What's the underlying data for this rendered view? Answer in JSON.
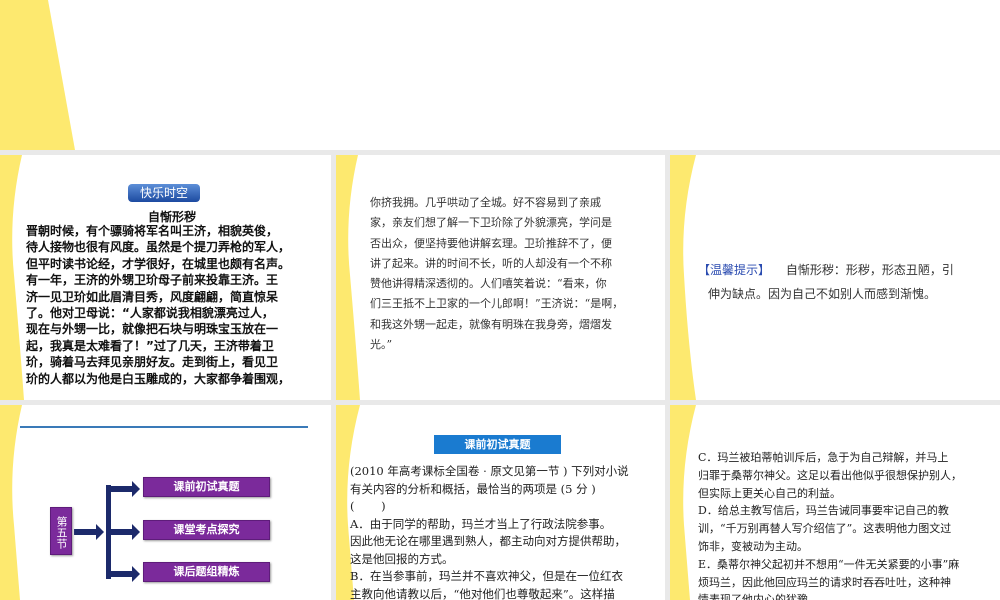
{
  "slides": [
    {
      "id": "top"
    },
    {
      "badge": "快乐时空",
      "title": "自惭形秽",
      "lines": [
        "晋朝时候，有个骠骑将军名叫王济，相貌英俊，",
        "待人接物也很有风度。虽然是个提刀弄枪的军人，",
        "但平时读书论经，才学很好，在城里也颇有名声。",
        "有一年，王济的外甥卫玠母子前来投靠王济。王",
        "济一见卫玠如此眉清目秀，风度翩翩，简直惊呆",
        "了。他对卫母说：“人家都说我相貌漂亮过人，",
        "现在与外甥一比，就像把石块与明珠宝玉放在一",
        "起，我真是太难看了！”过了几天，王济带着卫",
        "玠，骑着马去拜见亲朋好友。走到街上，看见卫",
        "玠的人都以为他是白玉雕成的，大家都争着围观，"
      ]
    },
    {
      "lines": [
        "你挤我拥。几乎哄动了全城。好不容易到了亲戚",
        "家，亲友们想了解一下卫玠除了外貌漂亮，学问是",
        "否出众，便坚持要他讲解玄理。卫玠推辞不了，便",
        "讲了起来。讲的时间不长，听的人却没有一个不称",
        "赞他讲得精深透彻的。人们嘻笑着说：“看来，你",
        "们三王抵不上卫家的一个儿郎啊！”王济说：“是啊，",
        "和我这外甥一起走，就像有明珠在我身旁，熠熠发",
        "光。”"
      ]
    },
    {
      "tip_label": "【温馨提示】",
      "lines": [
        "自惭形秽：形秽，形态丑陋，引",
        "伸为缺点。因为自己不如别人而感到渐愧。"
      ]
    },
    {
      "section": "第五节",
      "items": [
        "课前初试真题",
        "课堂考点探究",
        "课后题组精炼"
      ]
    },
    {
      "badge": "课前初试真题",
      "lines": [
        "(2010 年高考课标全国卷 · 原文见第一节 ) 下列对小说",
        "有关内容的分析和概括，最恰当的两项是 (5 分 )",
        "(　　 )",
        "A．由于同学的帮助，玛兰才当上了行政法院参事。",
        "因此他无论在哪里遇到熟人，都主动向对方提供帮助，",
        "这是他回报的方式。",
        "B．在当参事前，玛兰并不喜欢神父，但是在一位红衣",
        "主教向他请教以后，“他对他们也尊敬起来”。这样描"
      ]
    },
    {
      "lines": [
        "C．玛兰被珀蒂帕训斥后，急于为自己辩解，并马上",
        "归罪于桑蒂尔神父。这足以看出他似乎很想保护别人，",
        "但实际上更关心自己的利益。",
        "D．给总主教写信后，玛兰告诫同事要牢记自己的教",
        "训，“千万别再替人写介绍信了”。这表明他力图文过",
        "饰非，变被动为主动。",
        "E．桑蒂尔神父起初并不想用“一件无关紧要的小事”麻",
        "烦玛兰，因此他回应玛兰的请求时吞吞吐吐，这种神",
        "情表现了他内心的犹豫。"
      ]
    }
  ],
  "colors": {
    "yellow": "#fde96f",
    "purple": "#7b2a9b",
    "navy": "#1c2a6b",
    "blue": "#1a7bd0"
  }
}
